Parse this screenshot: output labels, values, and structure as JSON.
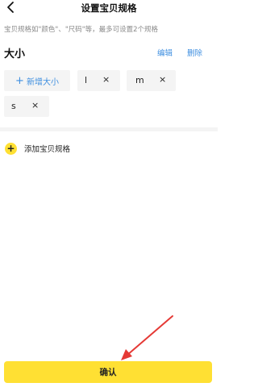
{
  "header": {
    "title": "设置宝贝规格",
    "back_icon": "chevron-left-icon"
  },
  "hint": "宝贝规格如\"颜色\"、\"尺码\"等，最多可设置2个规格",
  "spec_group": {
    "title": "大小",
    "edit_label": "编辑",
    "delete_label": "删除",
    "add_value_label": "新增大小",
    "add_value_plus": "+",
    "values": [
      {
        "value": "l",
        "remove": "×"
      },
      {
        "value": "m",
        "remove": "×"
      },
      {
        "value": "s",
        "remove": "×"
      }
    ]
  },
  "add_spec": {
    "icon": "+",
    "label": "添加宝贝规格"
  },
  "footer": {
    "confirm_label": "确认"
  },
  "colors": {
    "accent_yellow": "#ffe033",
    "link_blue": "#3f8fe0",
    "annotation_red": "#e53935"
  }
}
